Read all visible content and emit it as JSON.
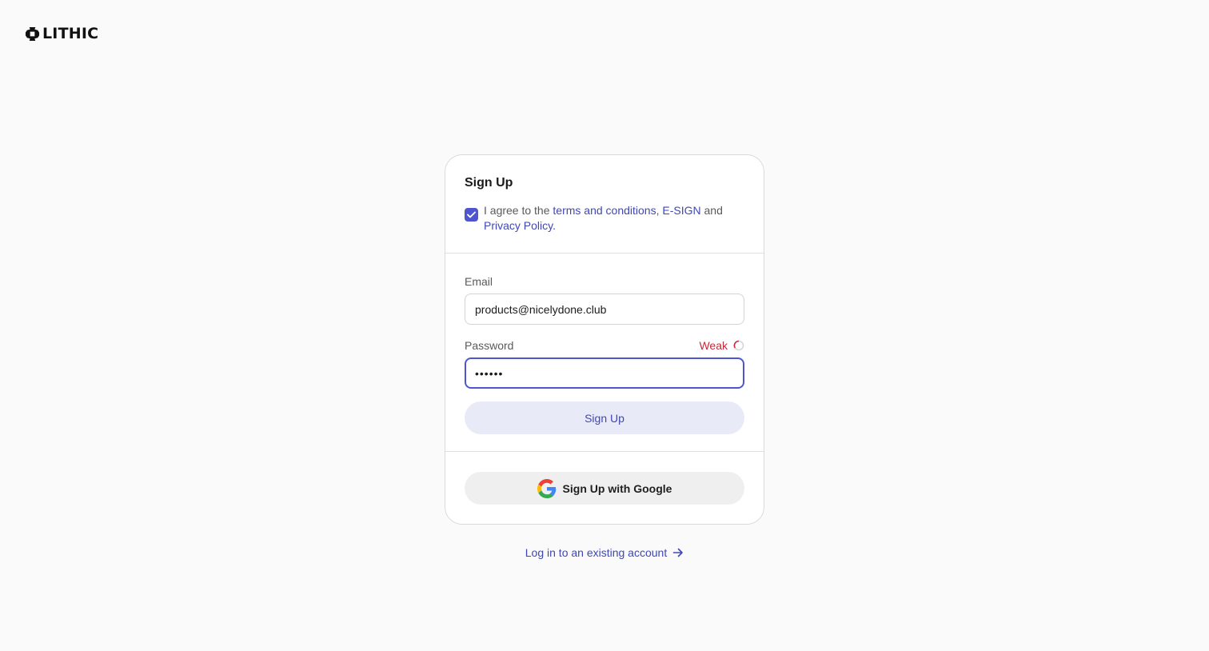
{
  "brand": {
    "name": "LITHIC",
    "logo_icon": "lithic-logo-icon"
  },
  "form": {
    "title": "Sign Up",
    "agreement": {
      "checked": true,
      "prefix": "I agree to the ",
      "terms_link": "terms and conditions",
      "comma": ",",
      "esign_link": "E-SIGN",
      "and": "and",
      "privacy_link": "Privacy Policy",
      "period": "."
    },
    "email": {
      "label": "Email",
      "value": "products@nicelydone.club"
    },
    "password": {
      "label": "Password",
      "masked_value": "••••••",
      "strength_label": "Weak",
      "strength_color": "#c7293a"
    },
    "submit_label": "Sign Up",
    "google_label": "Sign Up with Google"
  },
  "footer": {
    "login_link": "Log in to an existing account"
  },
  "colors": {
    "accent": "#4f55cf",
    "link": "#3f47b6",
    "background": "#fafafa"
  }
}
